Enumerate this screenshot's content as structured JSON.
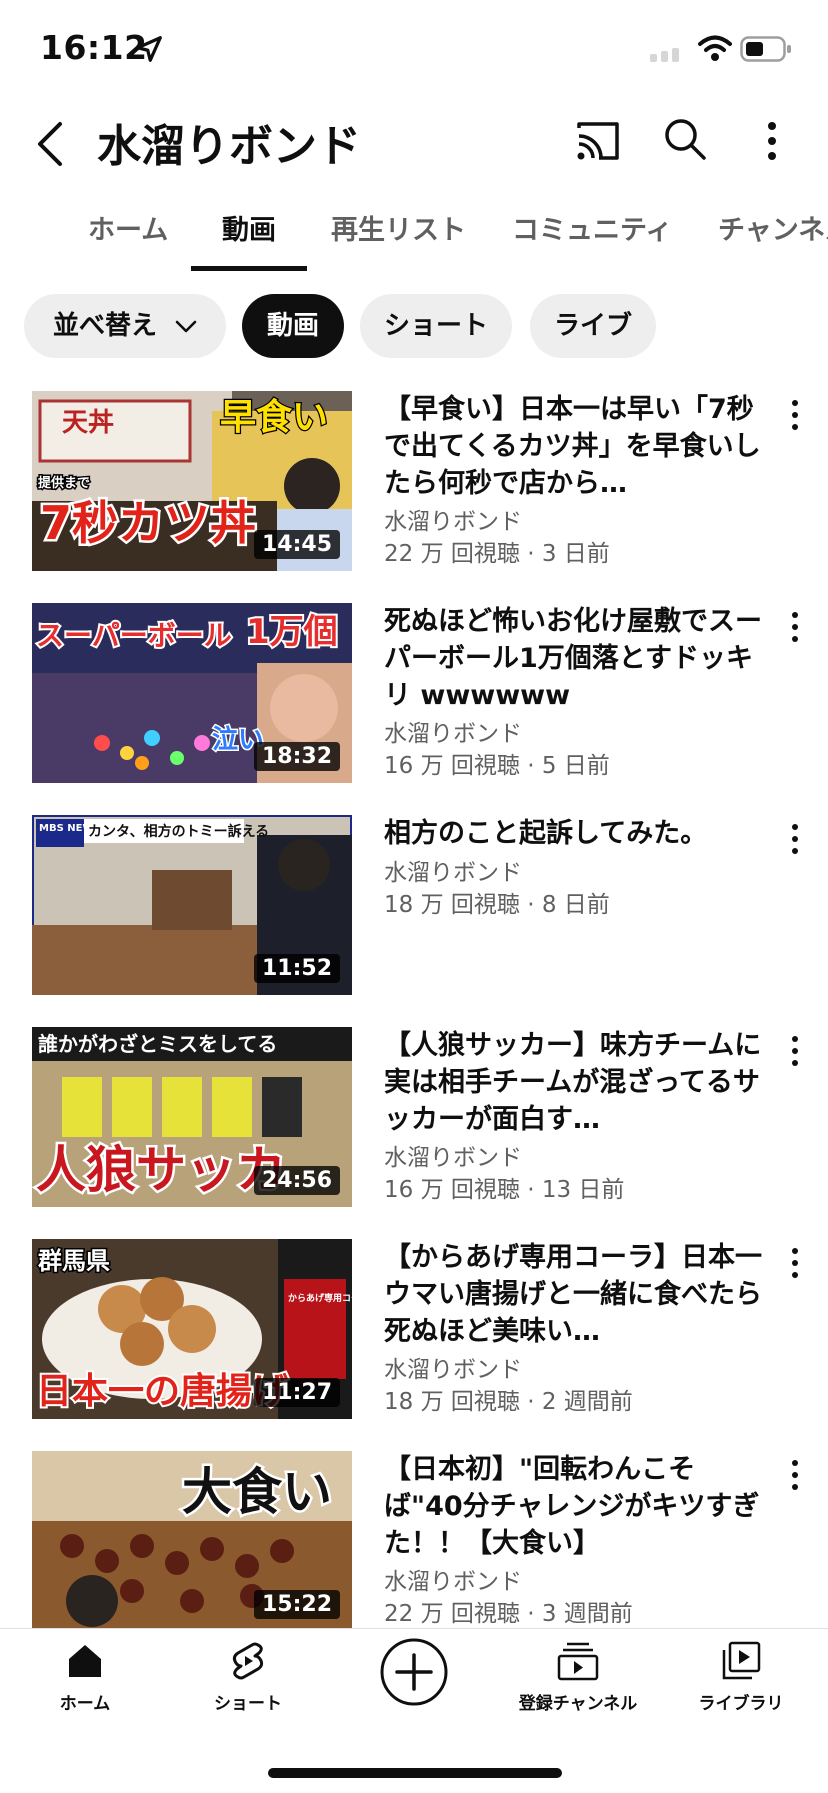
{
  "status": {
    "time": "16:12"
  },
  "appbar": {
    "title": "水溜りボンド"
  },
  "tabs": [
    {
      "label": "ホーム"
    },
    {
      "label": "動画"
    },
    {
      "label": "再生リスト"
    },
    {
      "label": "コミュニティ"
    },
    {
      "label": "チャンネル"
    }
  ],
  "chips": {
    "sort": "並べ替え",
    "items": [
      {
        "label": "動画"
      },
      {
        "label": "ショート"
      },
      {
        "label": "ライブ"
      }
    ]
  },
  "videos": [
    {
      "title": "【早食い】日本一は早い「7秒で出てくるカツ丼」を早食いしたら何秒で店から…",
      "channel": "水溜りボンド",
      "stats": "22 万 回視聴 · 3 日前",
      "duration": "14:45",
      "thumb_text_1": "早食い",
      "thumb_text_2": "7秒カツ丼",
      "thumb_text_3": "天丼",
      "thumb_text_4": "提供まで"
    },
    {
      "title": "死ぬほど怖いお化け屋敷でスーパーボール1万個落とすドッキリ wwwwww",
      "channel": "水溜りボンド",
      "stats": "16 万 回視聴 · 5 日前",
      "duration": "18:32",
      "thumb_text_1": "スーパーボール",
      "thumb_text_2": "1万個",
      "thumb_text_3": "泣い"
    },
    {
      "title": "相方のこと起訴してみた。",
      "channel": "水溜りボンド",
      "stats": "18 万 回視聴 · 8 日前",
      "duration": "11:52",
      "thumb_text_1": "MBS NEWS",
      "thumb_text_2": "カンタ、相方のトミー訴える"
    },
    {
      "title": "【人狼サッカー】味方チームに実は相手チームが混ざってるサッカーが面白す…",
      "channel": "水溜りボンド",
      "stats": "16 万 回視聴 · 13 日前",
      "duration": "24:56",
      "thumb_text_1": "誰かがわざとミスをしてる",
      "thumb_text_2": "人狼サッカ"
    },
    {
      "title": "【からあげ専用コーラ】日本一ウマい唐揚げと一緒に食べたら死ぬほど美味い…",
      "channel": "水溜りボンド",
      "stats": "18 万 回視聴 · 2 週間前",
      "duration": "11:27",
      "thumb_text_1": "群馬県",
      "thumb_text_2": "日本一の唐揚げ",
      "thumb_text_3": "からあげ専用コーラ"
    },
    {
      "title": "【日本初】\"回転わんこそば\"40分チャレンジがキツすぎた！！【大食い】",
      "channel": "水溜りボンド",
      "stats": "22 万 回視聴 · 3 週間前",
      "duration": "15:22",
      "thumb_text_1": "大食い"
    }
  ],
  "nav": [
    {
      "label": "ホーム",
      "icon": "home-icon"
    },
    {
      "label": "ショート",
      "icon": "shorts-icon"
    },
    {
      "label": "",
      "icon": "create-icon"
    },
    {
      "label": "登録チャンネル",
      "icon": "subscriptions-icon"
    },
    {
      "label": "ライブラリ",
      "icon": "library-icon"
    }
  ]
}
